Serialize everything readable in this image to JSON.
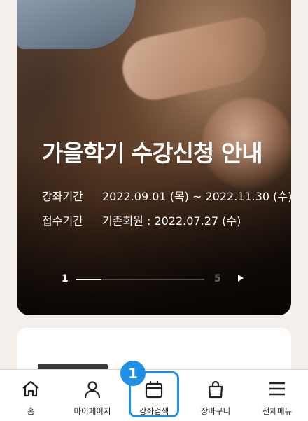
{
  "banner": {
    "title": "가을학기 수강신청 안내",
    "rows": [
      {
        "label": "강좌기간",
        "value": "2022.09.01 (목) ~ 2022.11.30 (수)"
      },
      {
        "label": "접수기간",
        "value": "기존회원 : 2022.07.27 (수)"
      }
    ],
    "pager": {
      "current": "1",
      "total": "5",
      "progress": 0.2
    }
  },
  "tabbar": {
    "items": [
      {
        "label": "홈",
        "icon": "home-icon"
      },
      {
        "label": "마이페이지",
        "icon": "person-icon"
      },
      {
        "label": "강좌검색",
        "icon": "calendar-icon"
      },
      {
        "label": "장바구니",
        "icon": "bag-icon"
      },
      {
        "label": "전체메뉴",
        "icon": "menu-icon"
      }
    ]
  },
  "annotation": {
    "step": "1",
    "color": "#1e8fe6"
  }
}
